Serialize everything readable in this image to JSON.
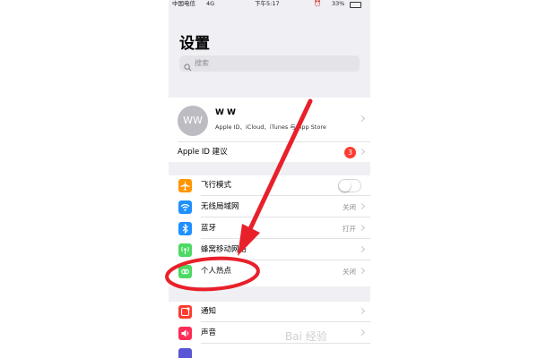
{
  "status": {
    "carrier": "中国电信",
    "network": "4G",
    "time": "下午5:17",
    "battery": "33%"
  },
  "title": "设置",
  "search": {
    "placeholder": "搜索"
  },
  "profile": {
    "initials": "WW",
    "name": "W W",
    "subtitle": "Apple ID、iCloud、iTunes 与 App Store"
  },
  "apple_id_suggestions": {
    "label": "Apple ID 建议",
    "badge": "3"
  },
  "connectivity": [
    {
      "label": "飞行模式",
      "icon": "airplane-icon",
      "color": "#ff9500",
      "value": "",
      "toggle": false
    },
    {
      "label": "无线局域网",
      "icon": "wifi-icon",
      "color": "#1e90ff",
      "value": "关闭"
    },
    {
      "label": "蓝牙",
      "icon": "bluetooth-icon",
      "color": "#1e90ff",
      "value": "打开"
    },
    {
      "label": "蜂窝移动网络",
      "icon": "cellular-icon",
      "color": "#4cd964",
      "value": ""
    },
    {
      "label": "个人热点",
      "icon": "hotspot-icon",
      "color": "#4cd964",
      "value": "关闭"
    }
  ],
  "notifications": [
    {
      "label": "通知",
      "icon": "notifications-icon",
      "color": "#ff3b30"
    },
    {
      "label": "声音",
      "icon": "sound-icon",
      "color": "#ff2d55"
    }
  ],
  "annotation": {
    "arrow_color": "#e8202a",
    "circle_color": "#e8202a"
  }
}
